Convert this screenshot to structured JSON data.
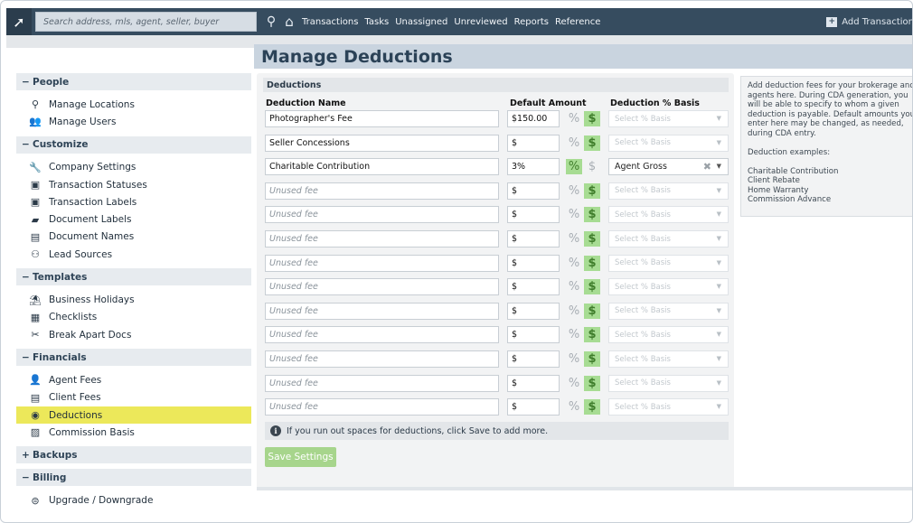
{
  "topbar": {
    "search_placeholder": "Search address, mls, agent, seller, buyer",
    "nav": [
      "Transactions",
      "Tasks",
      "Unassigned",
      "Unreviewed",
      "Reports",
      "Reference"
    ],
    "add_transaction": "Add Transaction"
  },
  "sidebar": {
    "sections": [
      {
        "symbol": "−",
        "title": "People",
        "items": [
          {
            "icon": "map-pin-icon",
            "glyph": "⚲",
            "label": "Manage Locations"
          },
          {
            "icon": "users-icon",
            "glyph": "👥",
            "label": "Manage Users"
          }
        ]
      },
      {
        "symbol": "−",
        "title": "Customize",
        "items": [
          {
            "icon": "wrench-icon",
            "glyph": "🔧",
            "label": "Company Settings"
          },
          {
            "icon": "status-icon",
            "glyph": "▣",
            "label": "Transaction Statuses"
          },
          {
            "icon": "label-icon",
            "glyph": "▣",
            "label": "Transaction Labels"
          },
          {
            "icon": "document-label-icon",
            "glyph": "▰",
            "label": "Document Labels"
          },
          {
            "icon": "document-name-icon",
            "glyph": "▤",
            "label": "Document Names"
          },
          {
            "icon": "lead-source-icon",
            "glyph": "⚇",
            "label": "Lead Sources"
          }
        ]
      },
      {
        "symbol": "−",
        "title": "Templates",
        "items": [
          {
            "icon": "beach-icon",
            "glyph": "⛱",
            "label": "Business Holidays"
          },
          {
            "icon": "checklist-icon",
            "glyph": "▦",
            "label": "Checklists"
          },
          {
            "icon": "break-apart-icon",
            "glyph": "✂",
            "label": "Break Apart Docs"
          }
        ]
      },
      {
        "symbol": "−",
        "title": "Financials",
        "items": [
          {
            "icon": "agent-fee-icon",
            "glyph": "👤",
            "label": "Agent Fees"
          },
          {
            "icon": "client-fee-icon",
            "glyph": "▤",
            "label": "Client Fees"
          },
          {
            "icon": "deductions-icon",
            "glyph": "◉",
            "label": "Deductions",
            "active": true
          },
          {
            "icon": "commission-basis-icon",
            "glyph": "▨",
            "label": "Commission Basis"
          }
        ]
      },
      {
        "symbol": "+",
        "title": "Backups",
        "items": []
      },
      {
        "symbol": "−",
        "title": "Billing",
        "items": [
          {
            "icon": "upgrade-icon",
            "glyph": "⊜",
            "label": "Upgrade / Downgrade"
          }
        ]
      }
    ]
  },
  "main": {
    "title": "Manage Deductions",
    "section_label": "Deductions",
    "columns": {
      "name": "Deduction Name",
      "amount": "Default Amount",
      "basis": "Deduction % Basis"
    },
    "basis_placeholder": "Select % Basis",
    "rows": [
      {
        "name": "Photographer's Fee",
        "amount": "$150.00",
        "mode": "usd",
        "basis": ""
      },
      {
        "name": "Seller Concessions",
        "amount": "$",
        "mode": "usd",
        "basis": ""
      },
      {
        "name": "Charitable Contribution",
        "amount": "3%",
        "mode": "pct",
        "basis": "Agent Gross"
      },
      {
        "name": "",
        "amount": "$",
        "mode": "usd",
        "basis": ""
      },
      {
        "name": "",
        "amount": "$",
        "mode": "usd",
        "basis": ""
      },
      {
        "name": "",
        "amount": "$",
        "mode": "usd",
        "basis": ""
      },
      {
        "name": "",
        "amount": "$",
        "mode": "usd",
        "basis": ""
      },
      {
        "name": "",
        "amount": "$",
        "mode": "usd",
        "basis": ""
      },
      {
        "name": "",
        "amount": "$",
        "mode": "usd",
        "basis": ""
      },
      {
        "name": "",
        "amount": "$",
        "mode": "usd",
        "basis": ""
      },
      {
        "name": "",
        "amount": "$",
        "mode": "usd",
        "basis": ""
      },
      {
        "name": "",
        "amount": "$",
        "mode": "usd",
        "basis": ""
      },
      {
        "name": "",
        "amount": "$",
        "mode": "usd",
        "basis": ""
      }
    ],
    "unused_placeholder": "Unused fee",
    "note": "If you run out spaces for deductions, click Save to add more.",
    "save_button": "Save Settings"
  },
  "help": {
    "lines": [
      "Add deduction fees for your brokerage and",
      "agents here. During CDA generation, you",
      "will be able to specify to whom a given",
      "deduction is payable. Default amounts you",
      "enter here may be changed, as needed,",
      "during CDA entry.",
      "",
      "Deduction examples:",
      "",
      "Charitable Contribution",
      "Client Rebate",
      "Home Warranty",
      "Commission Advance"
    ]
  },
  "colors": {
    "topbar": "#364c5f",
    "active_item": "#ece85a",
    "toggle_on": "#a7dc93",
    "save_button": "#a7d58c"
  }
}
